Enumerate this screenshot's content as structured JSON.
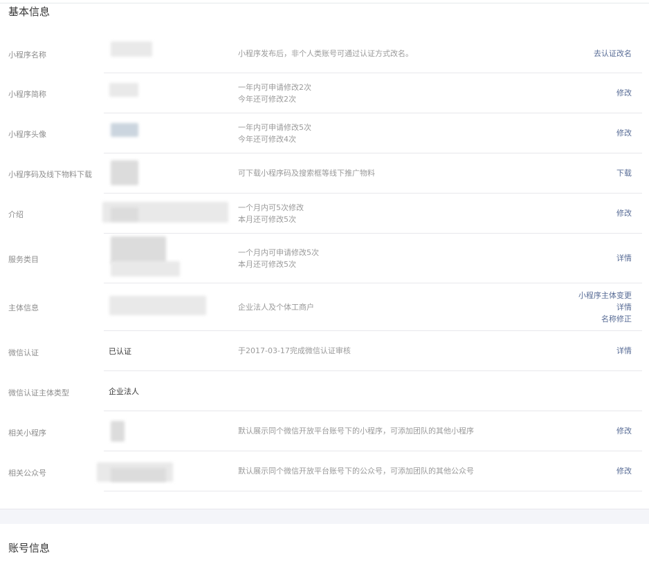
{
  "sections": {
    "basic_title": "基本信息",
    "account_title": "账号信息"
  },
  "rows": {
    "name": {
      "label": "小程序名称",
      "desc1": "小程序发布后，非个人类账号可通过认证方式改名。",
      "action1": "去认证改名"
    },
    "short_name": {
      "label": "小程序简称",
      "desc1": "一年内可申请修改2次",
      "desc2": "今年还可修改2次",
      "action1": "修改"
    },
    "avatar": {
      "label": "小程序头像",
      "desc1": "一年内可申请修改5次",
      "desc2": "今年还可修改4次",
      "action1": "修改"
    },
    "qrcode": {
      "label": "小程序码及线下物料下载",
      "desc1": "可下载小程序码及搜索框等线下推广物料",
      "action1": "下载"
    },
    "intro": {
      "label": "介绍",
      "desc1": "一个月内可5次修改",
      "desc2": "本月还可修改5次",
      "action1": "修改"
    },
    "category": {
      "label": "服务类目",
      "desc1": "一个月内可申请修改5次",
      "desc2": "本月还可修改5次",
      "action1": "详情"
    },
    "subject": {
      "label": "主体信息",
      "desc1": "企业法人及个体工商户",
      "action1": "小程序主体变更",
      "action2": "详情",
      "action3": "名称修正"
    },
    "wx_cert": {
      "label": "微信认证",
      "value": "已认证",
      "desc1": "于2017-03-17完成微信认证审核",
      "action1": "详情"
    },
    "cert_type": {
      "label": "微信认证主体类型",
      "value": "企业法人"
    },
    "related_mp": {
      "label": "相关小程序",
      "desc1": "默认展示同个微信开放平台账号下的小程序，可添加团队的其他小程序",
      "action1": "修改"
    },
    "related_oa": {
      "label": "相关公众号",
      "desc1": "默认展示同个微信开放平台账号下的公众号，可添加团队的其他公众号",
      "action1": "修改"
    }
  }
}
